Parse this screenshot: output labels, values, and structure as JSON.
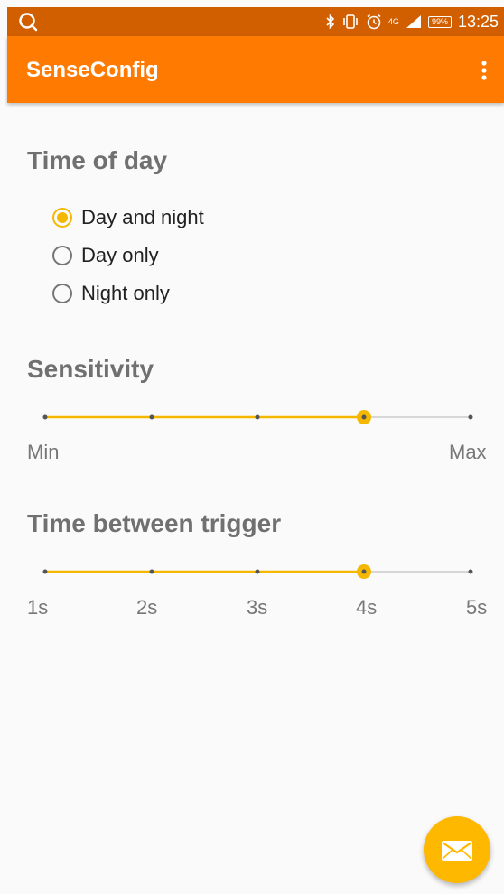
{
  "status_bar": {
    "time": "13:25",
    "battery": "99%",
    "network": "4G",
    "icons": [
      "search-icon",
      "bluetooth-icon",
      "vibrate-icon",
      "alarm-icon",
      "signal-icon",
      "battery-icon"
    ]
  },
  "app_bar": {
    "title": "SenseConfig",
    "menu_icon": "overflow-menu-icon"
  },
  "time_of_day": {
    "title": "Time of day",
    "options": [
      {
        "label": "Day and night",
        "selected": true
      },
      {
        "label": "Day only",
        "selected": false
      },
      {
        "label": "Night only",
        "selected": false
      }
    ]
  },
  "sensitivity": {
    "title": "Sensitivity",
    "min_label": "Min",
    "max_label": "Max",
    "steps": 5,
    "value_index": 3
  },
  "trigger_time": {
    "title": "Time between trigger",
    "labels": [
      "1s",
      "2s",
      "3s",
      "4s",
      "5s"
    ],
    "value_index": 3
  },
  "fab": {
    "icon": "mail-icon"
  },
  "colors": {
    "status_bar": "#d15f00",
    "app_bar": "#ff7a00",
    "accent": "#f5b800",
    "fab": "#ffb800"
  }
}
